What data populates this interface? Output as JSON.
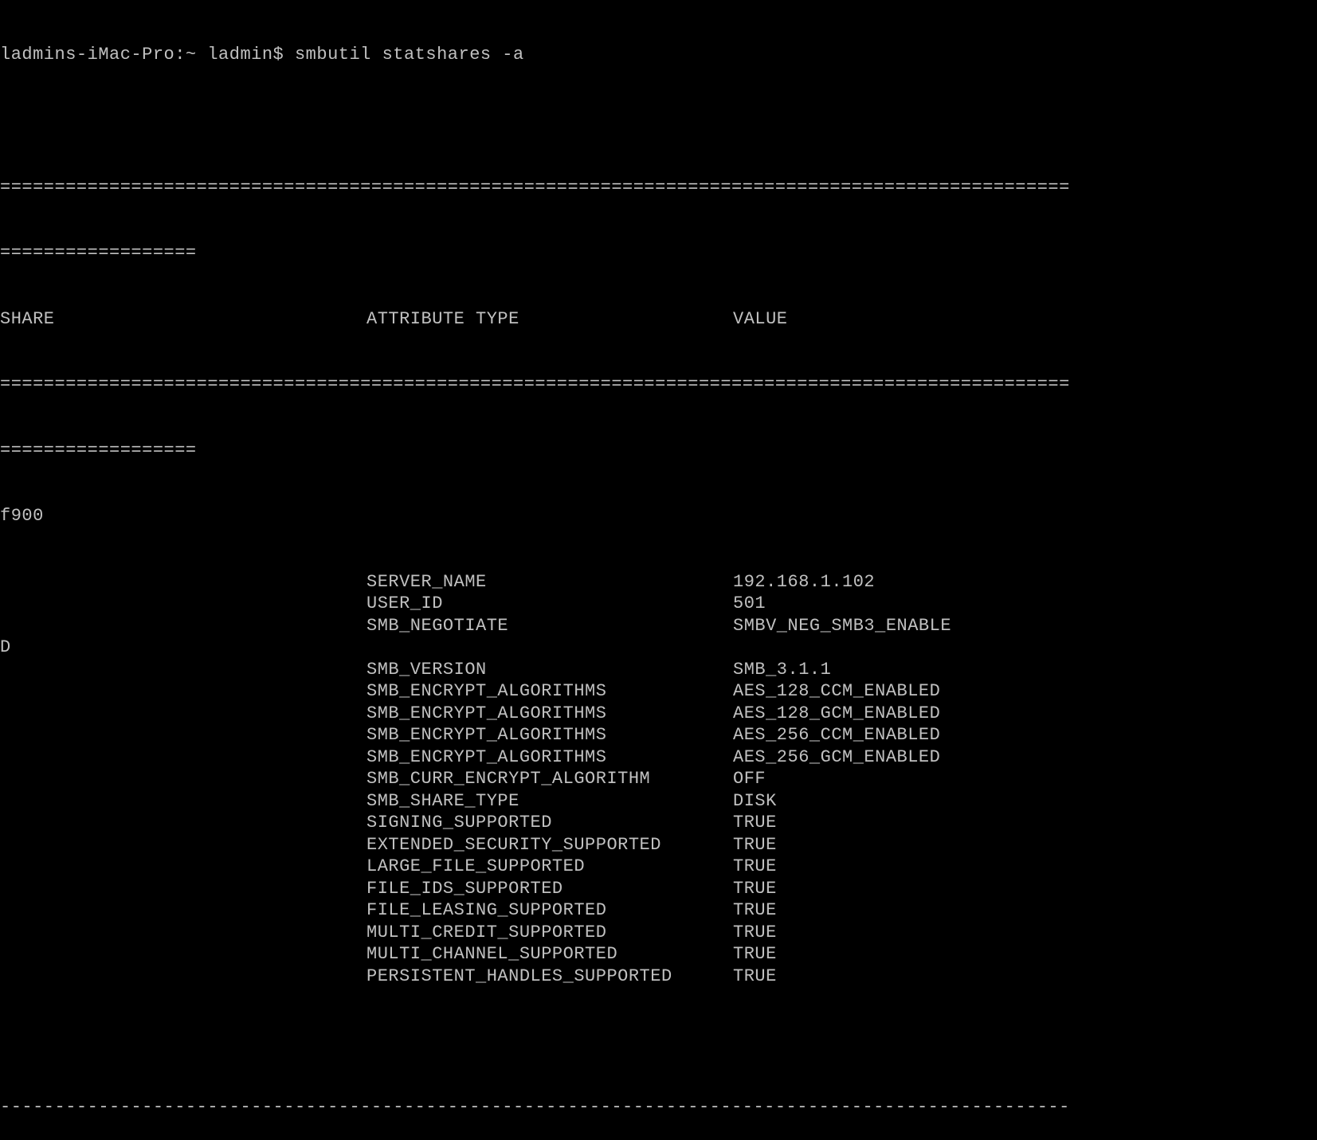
{
  "prompt": "ladmins-iMac-Pro:~ ladmin$ smbutil statshares -a",
  "separator1": "==================================================================================================",
  "separator2": "==================",
  "headers": {
    "share": "SHARE",
    "attribute": "ATTRIBUTE TYPE",
    "value": "VALUE"
  },
  "share_name": "f900",
  "wrap_char": "D",
  "attributes": [
    {
      "attr": "SERVER_NAME",
      "value": "192.168.1.102"
    },
    {
      "attr": "USER_ID",
      "value": "501"
    },
    {
      "attr": "SMB_NEGOTIATE",
      "value": "SMBV_NEG_SMB3_ENABLE"
    },
    {
      "attr": "",
      "value": ""
    },
    {
      "attr": "SMB_VERSION",
      "value": "SMB_3.1.1"
    },
    {
      "attr": "SMB_ENCRYPT_ALGORITHMS",
      "value": "AES_128_CCM_ENABLED"
    },
    {
      "attr": "SMB_ENCRYPT_ALGORITHMS",
      "value": "AES_128_GCM_ENABLED"
    },
    {
      "attr": "SMB_ENCRYPT_ALGORITHMS",
      "value": "AES_256_CCM_ENABLED"
    },
    {
      "attr": "SMB_ENCRYPT_ALGORITHMS",
      "value": "AES_256_GCM_ENABLED"
    },
    {
      "attr": "SMB_CURR_ENCRYPT_ALGORITHM",
      "value": "OFF"
    },
    {
      "attr": "SMB_SHARE_TYPE",
      "value": "DISK"
    },
    {
      "attr": "SIGNING_SUPPORTED",
      "value": "TRUE"
    },
    {
      "attr": "EXTENDED_SECURITY_SUPPORTED",
      "value": "TRUE"
    },
    {
      "attr": "LARGE_FILE_SUPPORTED",
      "value": "TRUE"
    },
    {
      "attr": "FILE_IDS_SUPPORTED",
      "value": "TRUE"
    },
    {
      "attr": "FILE_LEASING_SUPPORTED",
      "value": "TRUE"
    },
    {
      "attr": "MULTI_CREDIT_SUPPORTED",
      "value": "TRUE"
    },
    {
      "attr": "MULTI_CHANNEL_SUPPORTED",
      "value": "TRUE"
    },
    {
      "attr": "PERSISTENT_HANDLES_SUPPORTED",
      "value": "TRUE"
    }
  ],
  "dash_separator": "--------------------------------------------------------------------------------------------------"
}
